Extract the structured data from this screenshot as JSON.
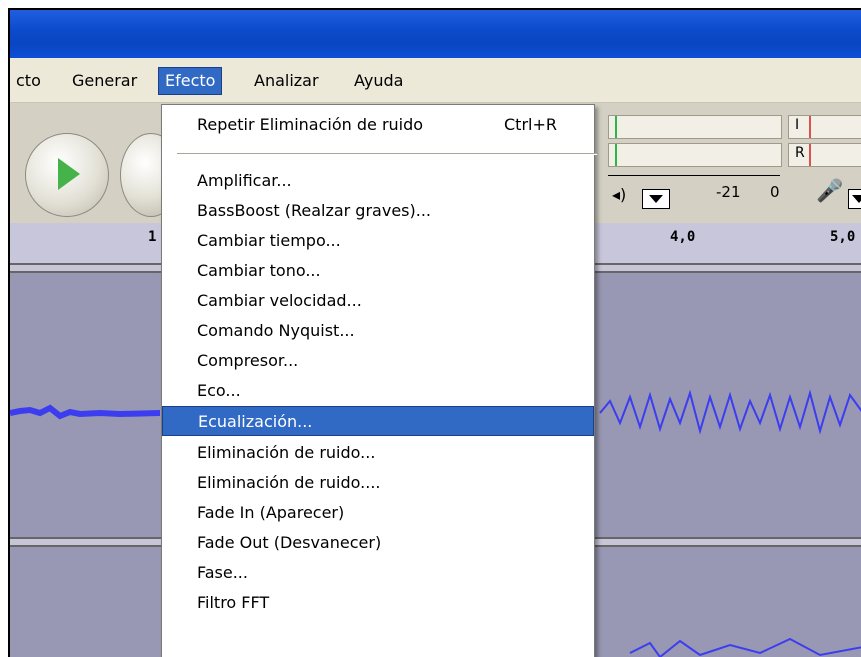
{
  "menubar": {
    "items": [
      "cto",
      "Generar",
      "Efecto",
      "Analizar",
      "Ayuda"
    ]
  },
  "toolbar": {
    "meter_marks": [
      "-21",
      "0"
    ],
    "meter_channels": [
      "I",
      "R"
    ]
  },
  "ruler": {
    "labels": [
      "1",
      "4,0",
      "5,0"
    ]
  },
  "effect_menu": {
    "repeat_label": "Repetir Eliminación de ruido",
    "repeat_shortcut": "Ctrl+R",
    "items": [
      "Amplificar...",
      "BassBoost (Realzar graves)...",
      "Cambiar tiempo...",
      "Cambiar tono...",
      "Cambiar velocidad...",
      "Comando Nyquist...",
      "Compresor...",
      "Eco...",
      "Ecualización...",
      "Eliminación de ruido...",
      "Eliminación de ruido....",
      "Fade In (Aparecer)",
      "Fade Out (Desvanecer)",
      "Fase...",
      "Filtro FFT"
    ],
    "highlighted": "Ecualización..."
  },
  "colors": {
    "titlebar": "#0a45c2",
    "highlight": "#316ac5",
    "waveform": "#3d3df0",
    "track_bg": "#9898b4"
  },
  "icons": [
    "play-icon",
    "volume-icon",
    "microphone-icon",
    "dropdown-arrow-icon"
  ]
}
